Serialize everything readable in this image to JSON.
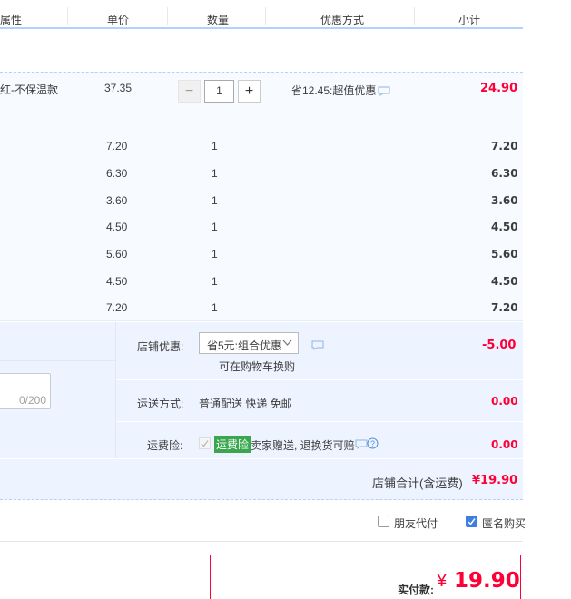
{
  "header": {
    "col_attr": "属性",
    "col_price": "单价",
    "col_qty": "数量",
    "col_discount": "优惠方式",
    "col_subtotal": "小计"
  },
  "main_item": {
    "attr": "红-不保温款",
    "unit_price": "37.35",
    "quantity": "1",
    "minus": "−",
    "plus": "+",
    "discount": "省12.45:超值优惠",
    "subtotal": "24.90"
  },
  "sub_items": [
    {
      "price": "7.20",
      "qty": "1",
      "subtotal": "7.20"
    },
    {
      "price": "6.30",
      "qty": "1",
      "subtotal": "6.30"
    },
    {
      "price": "3.60",
      "qty": "1",
      "subtotal": "3.60"
    },
    {
      "price": "4.50",
      "qty": "1",
      "subtotal": "4.50"
    },
    {
      "price": "5.60",
      "qty": "1",
      "subtotal": "5.60"
    },
    {
      "price": "4.50",
      "qty": "1",
      "subtotal": "4.50"
    },
    {
      "price": "7.20",
      "qty": "1",
      "subtotal": "7.20"
    }
  ],
  "shop": {
    "discount_label": "店铺优惠:",
    "discount_selected": "省5元:组合优惠",
    "discount_hint": "可在购物车换购",
    "discount_amount": "-5.00",
    "message_count": "0/200",
    "shipping_label": "运送方式:",
    "shipping_value": "普通配送 快递 免邮",
    "shipping_amount": "0.00",
    "insurance_label": "运费险:",
    "insurance_badge": "运费险",
    "insurance_desc": "卖家赠送, 退换货可赔",
    "insurance_amount": "0.00",
    "total_label": "店铺合计(含运费)",
    "total_value": "¥19.90"
  },
  "options": {
    "friend_pay": "朋友代付",
    "anonymous": "匿名购买"
  },
  "payment": {
    "label": "实付款:",
    "currency": "¥",
    "amount": "19.90"
  },
  "colors": {
    "accent_red": "#ff0036",
    "accent_blue": "#3d7fe0",
    "badge_green": "#3aa64d"
  }
}
